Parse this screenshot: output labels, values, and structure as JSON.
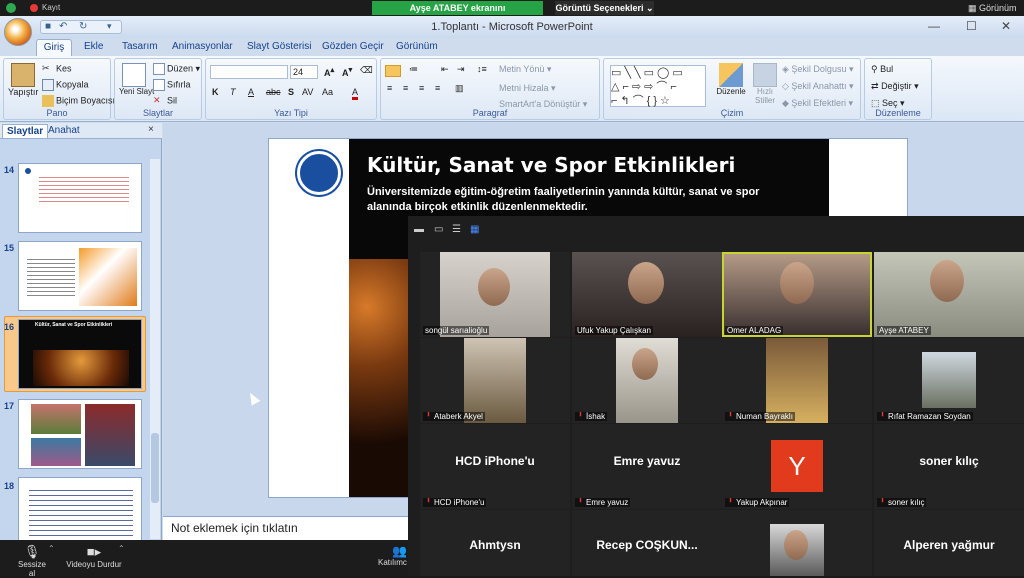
{
  "zoom": {
    "recording_label": "Kayıt",
    "share_banner": "Ayşe ATABEY ekranını görüntülüyorsunuz",
    "view_options": "Görüntü Seçenekleri",
    "view_button": "Görünüm",
    "bottom": {
      "mute_label": "Sessize al",
      "video_label": "Videoyu Durdur",
      "participants_label": "Katılımc"
    },
    "participants": [
      {
        "name": "songül sarıalioğlu",
        "muted": false,
        "video": true
      },
      {
        "name": "Ufuk Yakup Çalışkan",
        "muted": false,
        "video": true
      },
      {
        "name": "Omer ALADAG",
        "muted": false,
        "video": true,
        "active_speaker": true
      },
      {
        "name": "Ayşe ATABEY",
        "muted": false,
        "video": true
      },
      {
        "name": "Ataberk Akyel",
        "muted": true,
        "video": true
      },
      {
        "name": "İshak",
        "muted": true,
        "video": true
      },
      {
        "name": "Numan Bayraklı",
        "muted": true,
        "video": true
      },
      {
        "name": "Rıfat Ramazan Soydan",
        "muted": true,
        "video": true
      },
      {
        "name": "HCD iPhone'u",
        "display": "HCD iPhone'u",
        "muted": true,
        "video": false
      },
      {
        "name": "Emre yavuz",
        "display": "Emre yavuz",
        "muted": true,
        "video": false
      },
      {
        "name": "Yakup Akpınar",
        "avatar_letter": "Y",
        "muted": true,
        "video": false
      },
      {
        "name": "soner kılıç",
        "display": "soner kılıç",
        "muted": true,
        "video": false
      },
      {
        "display": "Ahmtysn",
        "video": false
      },
      {
        "display": "Recep  COŞKUN...",
        "video": false
      },
      {
        "display": "",
        "video": true
      },
      {
        "display": "Alperen yağmur",
        "video": false
      }
    ],
    "colors": {
      "banner_green": "#26a344",
      "active_speaker": "#c7d533",
      "muted_red": "#e53935"
    }
  },
  "ppt": {
    "window_title": "1.Toplantı - Microsoft PowerPoint",
    "tabs": [
      "Giriş",
      "Ekle",
      "Tasarım",
      "Animasyonlar",
      "Slayt Gösterisi",
      "Gözden Geçir",
      "Görünüm"
    ],
    "ribbon": {
      "clipboard": {
        "label": "Pano",
        "paste": "Yapıştır",
        "cut": "Kes",
        "copy": "Kopyala",
        "format_painter": "Biçim Boyacısı"
      },
      "slides": {
        "label": "Slaytlar",
        "new_slide": "Yeni Slayt",
        "layout": "Düzen",
        "reset": "Sıfırla",
        "delete": "Sil"
      },
      "font": {
        "label": "Yazı Tipi",
        "size": "24"
      },
      "paragraph": {
        "label": "Paragraf",
        "text_direction": "Metin Yönü",
        "align_text": "Metni Hizala",
        "smartart": "SmartArt'a Dönüştür"
      },
      "drawing": {
        "label": "Çizim",
        "arrange": "Düzenle",
        "quick_styles": "Hızlı Stiller",
        "shape_fill": "Şekil Dolgusu",
        "shape_outline": "Şekil Anahattı",
        "shape_effects": "Şekil Efektleri"
      },
      "editing": {
        "label": "Düzenleme",
        "find": "Bul",
        "replace": "Değiştir",
        "select": "Seç"
      }
    },
    "pane": {
      "tab_slides": "Slaytlar",
      "tab_outline": "Anahat",
      "close": "×",
      "thumb_numbers": [
        "14",
        "15",
        "16",
        "17",
        "18"
      ],
      "selected": "16"
    },
    "slide": {
      "title": "Kültür, Sanat ve Spor Etkinlikleri",
      "body": "Üniversitemizde eğitim-öğretim faaliyetlerinin yanında kültür, sanat ve spor alanında birçok etkinlik düzenlenmektedir."
    },
    "notes_placeholder": "Not eklemek için tıklatın",
    "thumb16_title": "Kültür, Sanat ve Spor Etkinlikleri"
  }
}
